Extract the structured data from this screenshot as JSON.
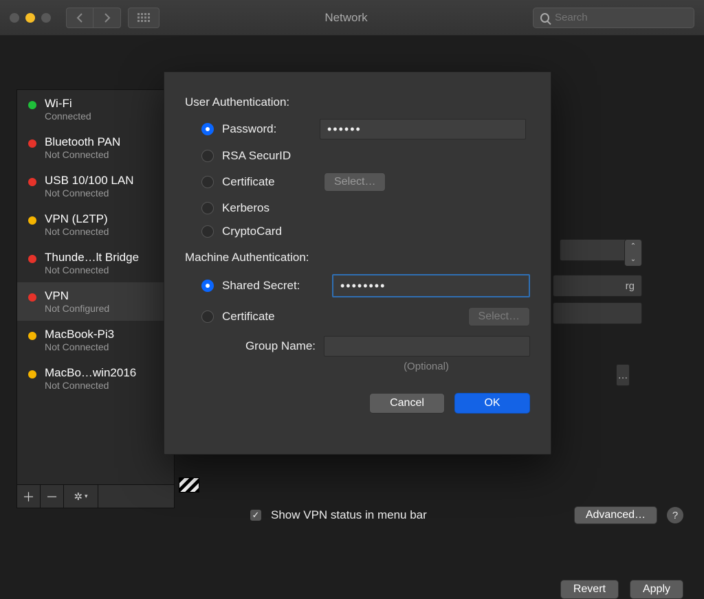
{
  "window": {
    "title": "Network"
  },
  "search": {
    "placeholder": "Search"
  },
  "sidebar": {
    "items": [
      {
        "name": "Wi-Fi",
        "status": "Connected",
        "color": "green",
        "selected": false
      },
      {
        "name": "Bluetooth PAN",
        "status": "Not Connected",
        "color": "red",
        "selected": false
      },
      {
        "name": "USB 10/100 LAN",
        "status": "Not Connected",
        "color": "red",
        "selected": false
      },
      {
        "name": "VPN (L2TP)",
        "status": "Not Connected",
        "color": "yellow",
        "selected": false
      },
      {
        "name": "Thunde…lt Bridge",
        "status": "Not Connected",
        "color": "red",
        "selected": false
      },
      {
        "name": "VPN",
        "status": "Not Configured",
        "color": "red",
        "selected": true
      },
      {
        "name": "MacBook-Pi3",
        "status": "Not Connected",
        "color": "yellow",
        "selected": false
      },
      {
        "name": "MacBo…win2016",
        "status": "Not Connected",
        "color": "yellow",
        "selected": false
      }
    ]
  },
  "sheet": {
    "user_auth_label": "User Authentication:",
    "options": {
      "password": "Password:",
      "securid": "RSA SecurID",
      "certificate": "Certificate",
      "kerberos": "Kerberos",
      "cryptocard": "CryptoCard"
    },
    "select_label1": "Select…",
    "password_value": "••••••",
    "machine_auth_label": "Machine Authentication:",
    "m_options": {
      "shared": "Shared Secret:",
      "cert": "Certificate"
    },
    "shared_value": "••••••••",
    "select_label2": "Select…",
    "group_label": "Group Name:",
    "optional": "(Optional)",
    "cancel": "Cancel",
    "ok": "OK"
  },
  "background": {
    "server_suffix": "rg",
    "ellipsis_btn": "…"
  },
  "footer": {
    "checkbox_label": "Show VPN status in menu bar",
    "advanced": "Advanced…",
    "revert": "Revert",
    "apply": "Apply"
  }
}
